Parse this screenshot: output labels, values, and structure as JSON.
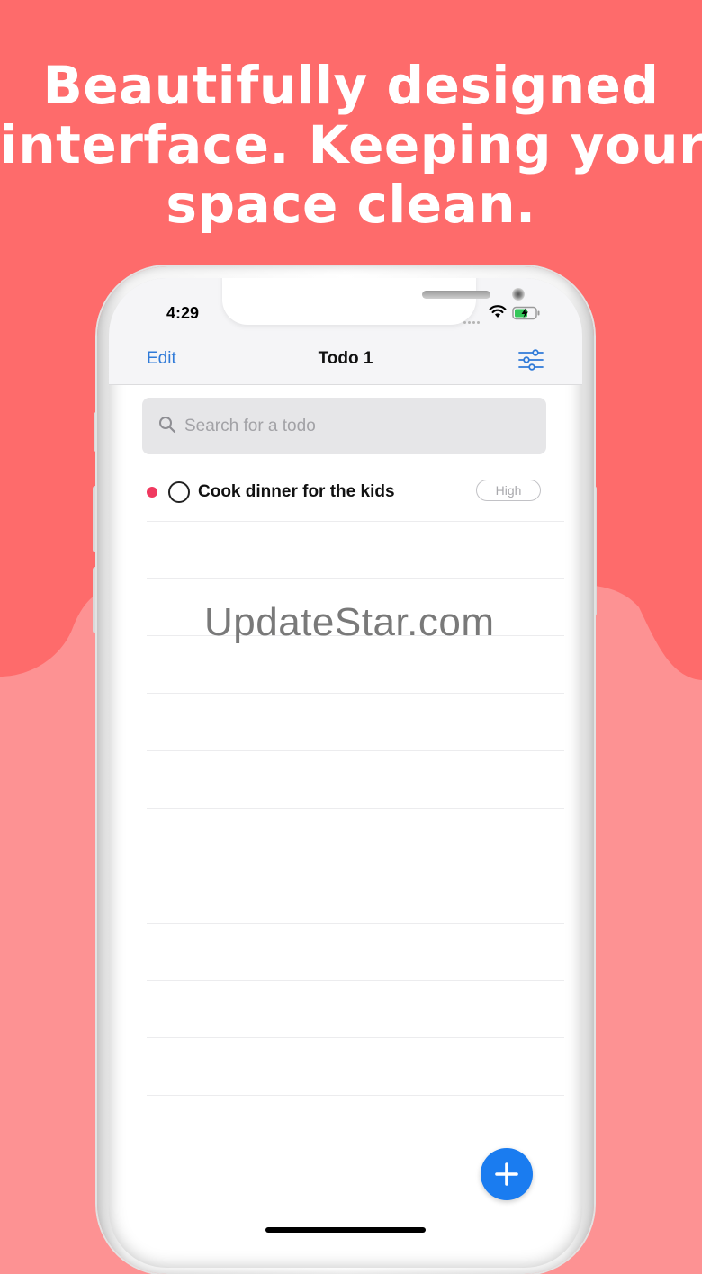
{
  "promo": {
    "headline_lines": [
      "Beautifully designed",
      "interface. Keeping your",
      "space clean."
    ]
  },
  "colors": {
    "background_top": "#fe6b6b",
    "background_bottom": "#fd9293",
    "accent_blue": "#2f7ad8",
    "fab_blue": "#1a7cf0",
    "priority_dot": "#f0395f"
  },
  "status_bar": {
    "time": "4:29"
  },
  "nav": {
    "edit_label": "Edit",
    "title": "Todo 1",
    "filter_icon": "sliders-icon"
  },
  "search": {
    "placeholder": "Search for a todo",
    "value": ""
  },
  "todos": [
    {
      "text": "Cook dinner for the kids",
      "priority": "High",
      "completed": false
    }
  ],
  "watermark": "UpdateStar.com",
  "fab": {
    "icon": "plus-icon"
  }
}
